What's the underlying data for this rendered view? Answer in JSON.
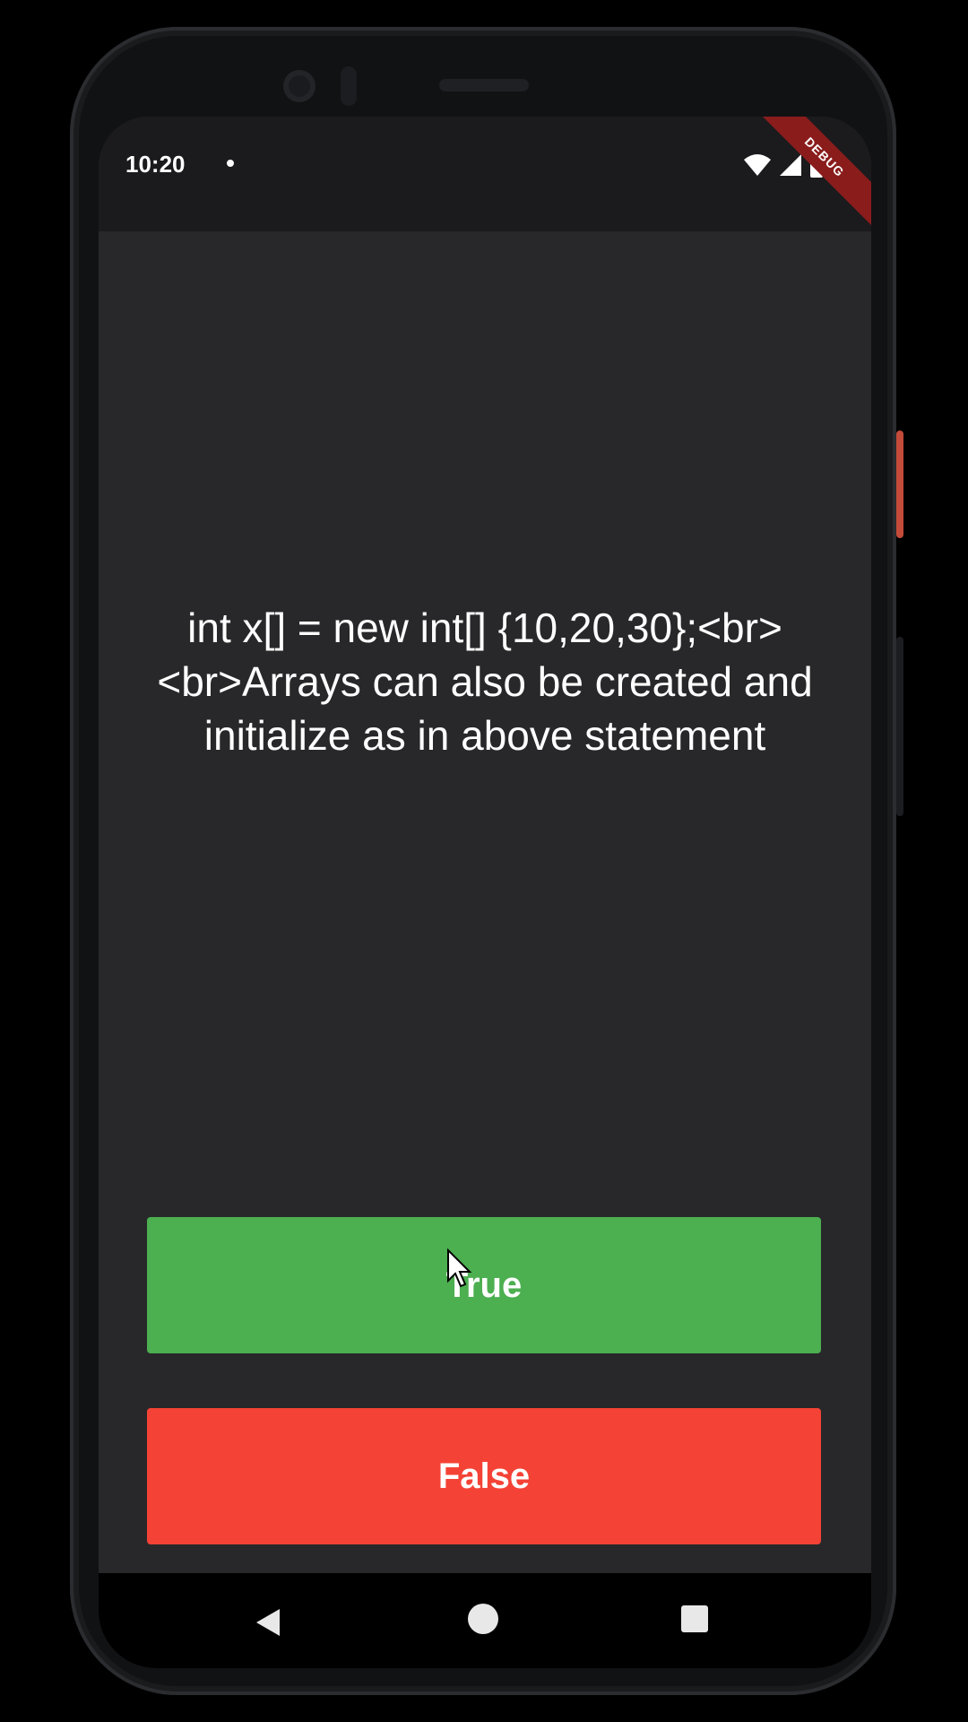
{
  "status_bar": {
    "time": "10:20",
    "debug_label": "DEBUG"
  },
  "quiz": {
    "question": "int x[] = new int[] {10,20,30};<br><br>Arrays can also be created and initialize as in above statement",
    "true_label": "True",
    "false_label": "False"
  },
  "colors": {
    "background": "#28282a",
    "true_button": "#4caf50",
    "false_button": "#f44336",
    "debug_ribbon": "#8a1c1c"
  },
  "icons": {
    "status": [
      "notification-dot-icon",
      "wifi-icon",
      "cellular-signal-icon",
      "battery-icon"
    ],
    "navigation": [
      "back-icon",
      "home-icon",
      "recents-icon"
    ]
  }
}
